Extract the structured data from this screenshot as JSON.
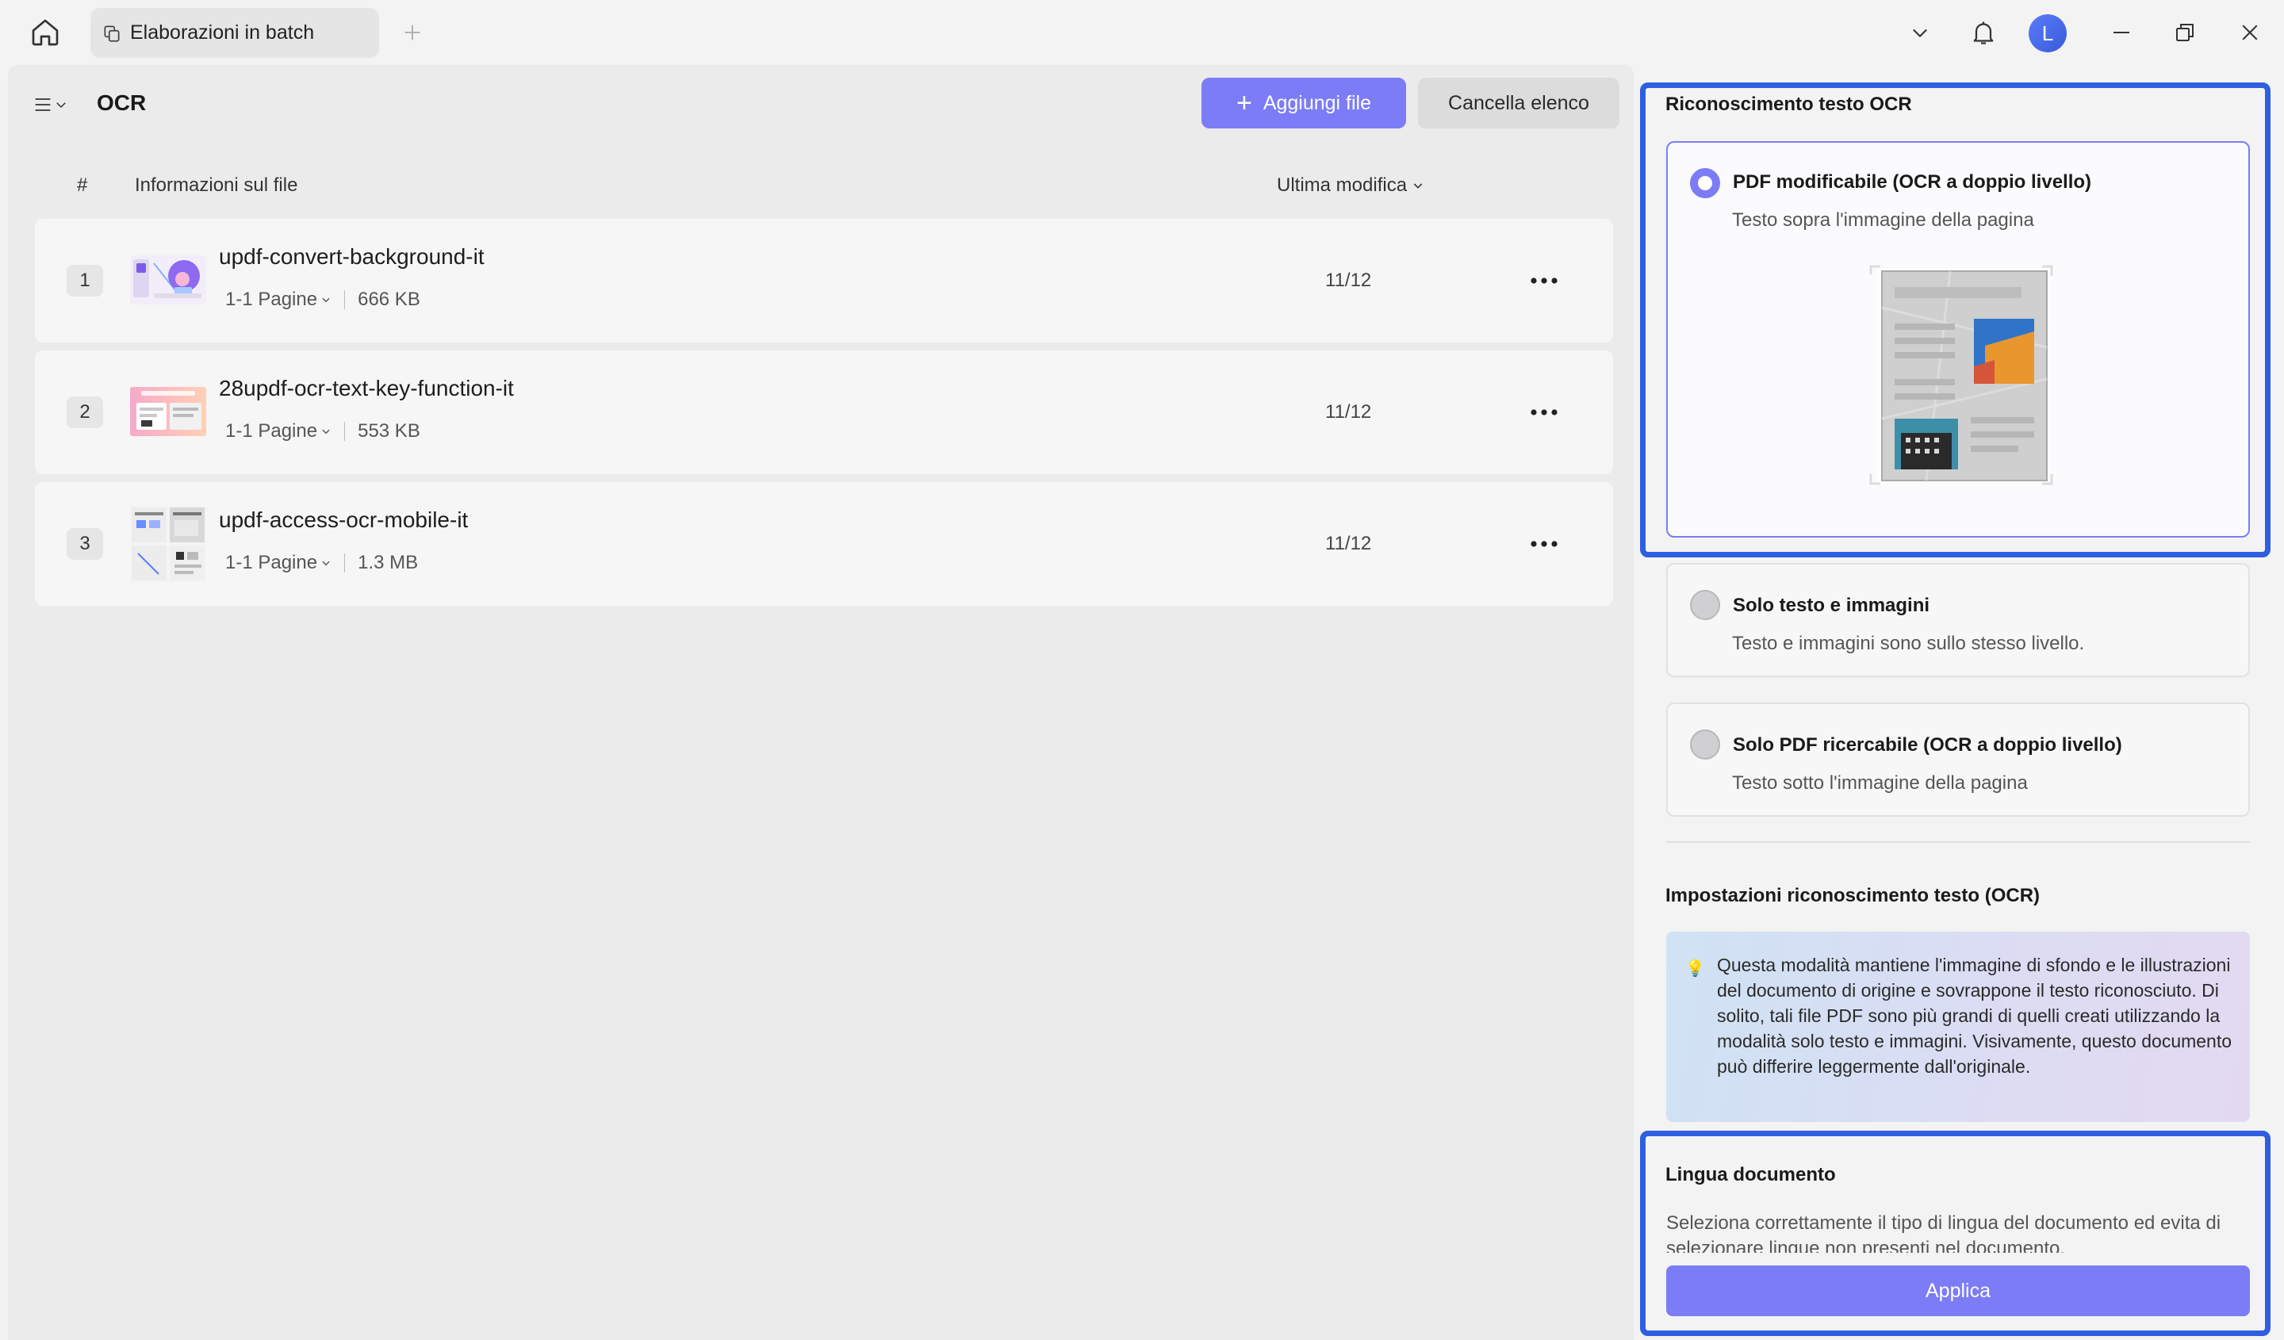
{
  "window": {
    "tab_label": "Elaborazioni in batch",
    "avatar_initial": "L"
  },
  "toolbar": {
    "title": "OCR",
    "add_label": "Aggiungi file",
    "clear_label": "Cancella elenco"
  },
  "list": {
    "headers": {
      "num": "#",
      "info": "Informazioni sul file",
      "modified": "Ultima modifica"
    },
    "files": [
      {
        "index": "1",
        "name": "updf-convert-background-it",
        "pages": "1-1 Pagine",
        "size": "666 KB",
        "date": "11/12"
      },
      {
        "index": "2",
        "name": "28updf-ocr-text-key-function-it",
        "pages": "1-1 Pagine",
        "size": "553 KB",
        "date": "11/12"
      },
      {
        "index": "3",
        "name": "updf-access-ocr-mobile-it",
        "pages": "1-1 Pagine",
        "size": "1.3 MB",
        "date": "11/12"
      }
    ]
  },
  "settings": {
    "ocr_title": "Riconoscimento testo OCR",
    "options": [
      {
        "title": "PDF modificabile (OCR a doppio livello)",
        "subtitle": "Testo sopra l'immagine della pagina",
        "selected": true
      },
      {
        "title": "Solo testo e immagini",
        "subtitle": "Testo e immagini sono sullo stesso livello.",
        "selected": false
      },
      {
        "title": "Solo PDF ricercabile (OCR a doppio livello)",
        "subtitle": "Testo sotto l'immagine della pagina",
        "selected": false
      }
    ],
    "settings_title": "Impostazioni riconoscimento testo (OCR)",
    "info_text": "Questa modalità mantiene l'immagine di sfondo e le illustrazioni del documento di origine e sovrappone il testo riconosciuto. Di solito, tali file PDF sono più grandi di quelli creati utilizzando la modalità solo testo e immagini. Visivamente, questo documento può differire leggermente dall'originale.",
    "language_title": "Lingua documento",
    "language_desc": "Seleziona correttamente il tipo di lingua del documento ed evita di selezionare lingue non presenti nel documento.",
    "apply_label": "Applica"
  },
  "colors": {
    "accent": "#7c7cf7",
    "highlight": "#2f5fe0"
  }
}
